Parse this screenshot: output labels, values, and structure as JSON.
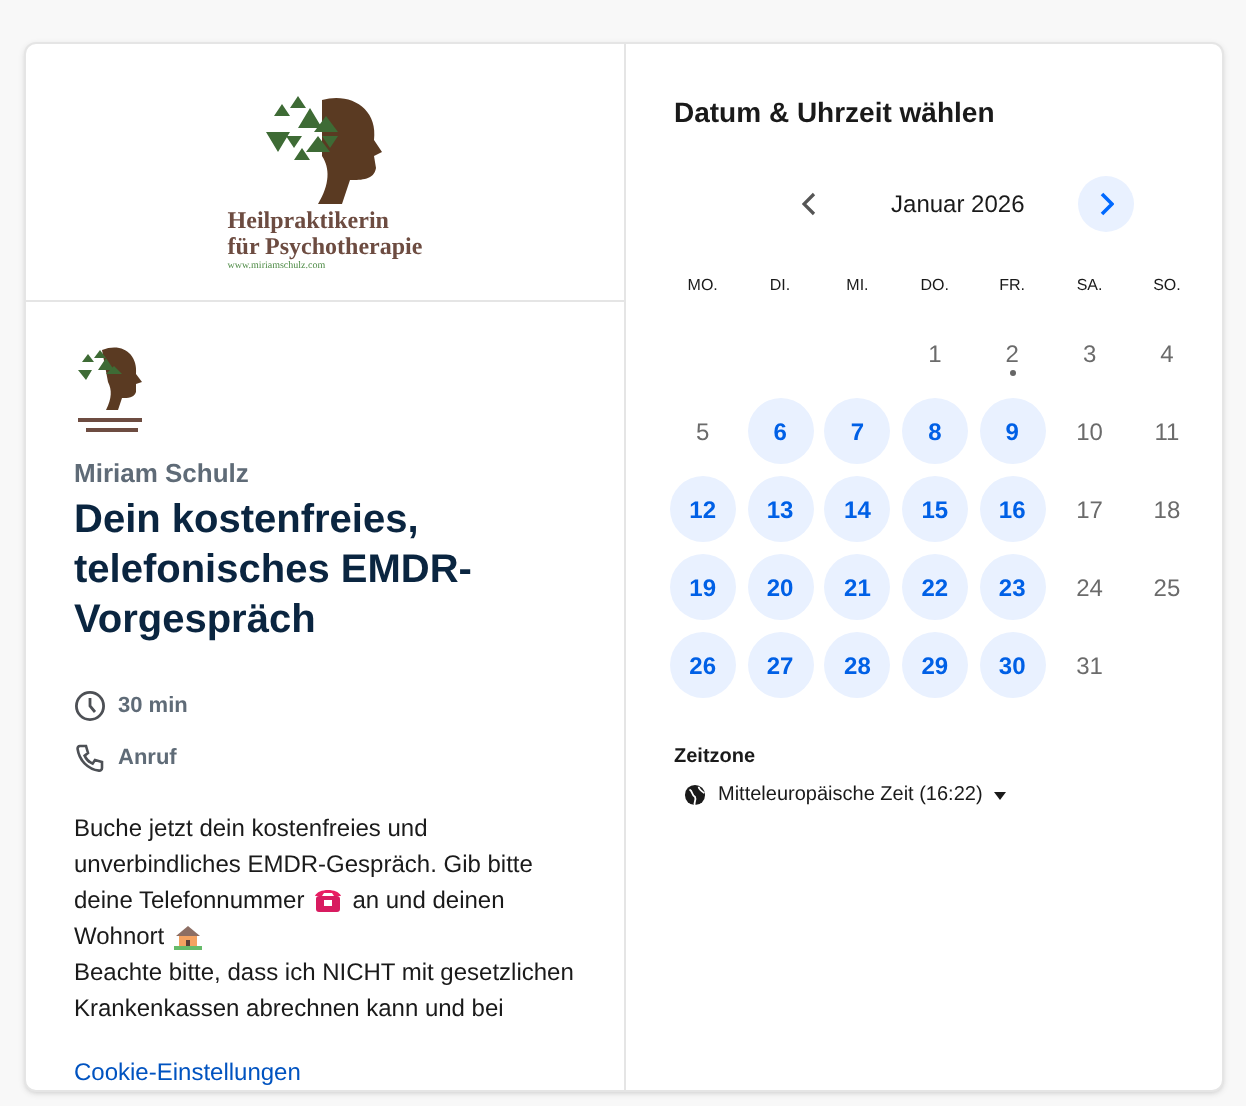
{
  "brand_logo": {
    "line_1": "Heilpraktikerin",
    "line_2": "für Psychotherapie",
    "website": "www.miriamschulz.com"
  },
  "event": {
    "host": "Miriam Schulz",
    "title": "Dein kostenfreies, telefonisches EMDR-Vorgespräch",
    "details": [
      {
        "kind": "duration",
        "text": "30 min"
      },
      {
        "kind": "call",
        "text": "Anruf"
      }
    ],
    "description_lines": [
      [
        {
          "kind": "text",
          "text": "Buche jetzt dein kostenfreies und"
        }
      ],
      [
        {
          "kind": "text",
          "text": "unverbindliches EMDR-Gespräch. Gib bitte"
        }
      ],
      [
        {
          "kind": "text",
          "text": "deine Telefonnummer"
        },
        {
          "kind": "phone"
        },
        {
          "kind": "text",
          "text": "an und deinen"
        }
      ],
      [
        {
          "kind": "text",
          "text": "Wohnort"
        },
        {
          "kind": "house"
        }
      ],
      [
        {
          "kind": "text",
          "text": "Beachte bitte, dass ich NICHT mit gesetzlichen"
        }
      ],
      [
        {
          "kind": "text",
          "text": "Krankenkassen abrechnen kann und bei"
        }
      ]
    ]
  },
  "cookie_link": "Cookie-Einstellungen",
  "calendar": {
    "heading": "Datum & Uhrzeit wählen",
    "month": "Januar 2026",
    "weekdays": [
      "MO.",
      "DI.",
      "MI.",
      "DO.",
      "FR.",
      "SA.",
      "SO."
    ],
    "days": [
      {
        "label": "1",
        "available": false,
        "today": false
      },
      {
        "label": "2",
        "available": false,
        "today": true
      },
      {
        "label": "3",
        "available": false,
        "today": false
      },
      {
        "label": "4",
        "available": false,
        "today": false
      },
      {
        "label": "5",
        "available": false,
        "today": false
      },
      {
        "label": "6",
        "available": true,
        "today": false
      },
      {
        "label": "7",
        "available": true,
        "today": false
      },
      {
        "label": "8",
        "available": true,
        "today": false
      },
      {
        "label": "9",
        "available": true,
        "today": false
      },
      {
        "label": "10",
        "available": false,
        "today": false
      },
      {
        "label": "11",
        "available": false,
        "today": false
      },
      {
        "label": "12",
        "available": true,
        "today": false
      },
      {
        "label": "13",
        "available": true,
        "today": false
      },
      {
        "label": "14",
        "available": true,
        "today": false
      },
      {
        "label": "15",
        "available": true,
        "today": false
      },
      {
        "label": "16",
        "available": true,
        "today": false
      },
      {
        "label": "17",
        "available": false,
        "today": false
      },
      {
        "label": "18",
        "available": false,
        "today": false
      },
      {
        "label": "19",
        "available": true,
        "today": false
      },
      {
        "label": "20",
        "available": true,
        "today": false
      },
      {
        "label": "21",
        "available": true,
        "today": false
      },
      {
        "label": "22",
        "available": true,
        "today": false
      },
      {
        "label": "23",
        "available": true,
        "today": false
      },
      {
        "label": "24",
        "available": false,
        "today": false
      },
      {
        "label": "25",
        "available": false,
        "today": false
      },
      {
        "label": "26",
        "available": true,
        "today": false
      },
      {
        "label": "27",
        "available": true,
        "today": false
      },
      {
        "label": "28",
        "available": true,
        "today": false
      },
      {
        "label": "29",
        "available": true,
        "today": false
      },
      {
        "label": "30",
        "available": true,
        "today": false
      },
      {
        "label": "31",
        "available": false,
        "today": false
      }
    ]
  },
  "timezone": {
    "label": "Zeitzone",
    "value": "Mitteleuropäische Zeit (16:22)"
  }
}
